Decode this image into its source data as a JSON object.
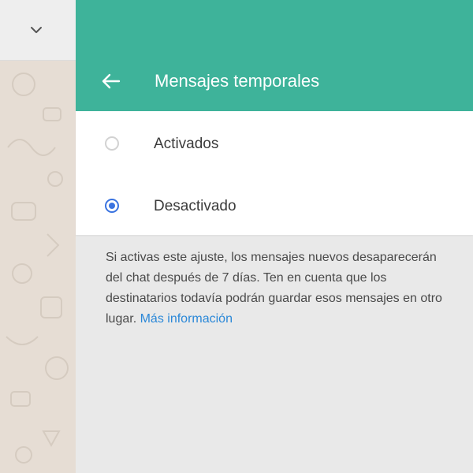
{
  "left_header": {
    "chevron_icon": "chevron-down-icon"
  },
  "drawer": {
    "back_icon": "arrow-left-icon",
    "title": "Mensajes temporales",
    "header_color": "#3eb39a"
  },
  "options": [
    {
      "label": "Activados",
      "selected": false
    },
    {
      "label": "Desactivado",
      "selected": true
    }
  ],
  "accent_color": "#3a73e0",
  "info": {
    "text": "Si activas este ajuste, los mensajes nuevos desaparecerán del chat después de 7 días. Ten en cuenta que los destinatarios todavía podrán guardar esos mensajes en otro lugar.",
    "link_label": "Más información",
    "link_color": "#2b88d8"
  }
}
